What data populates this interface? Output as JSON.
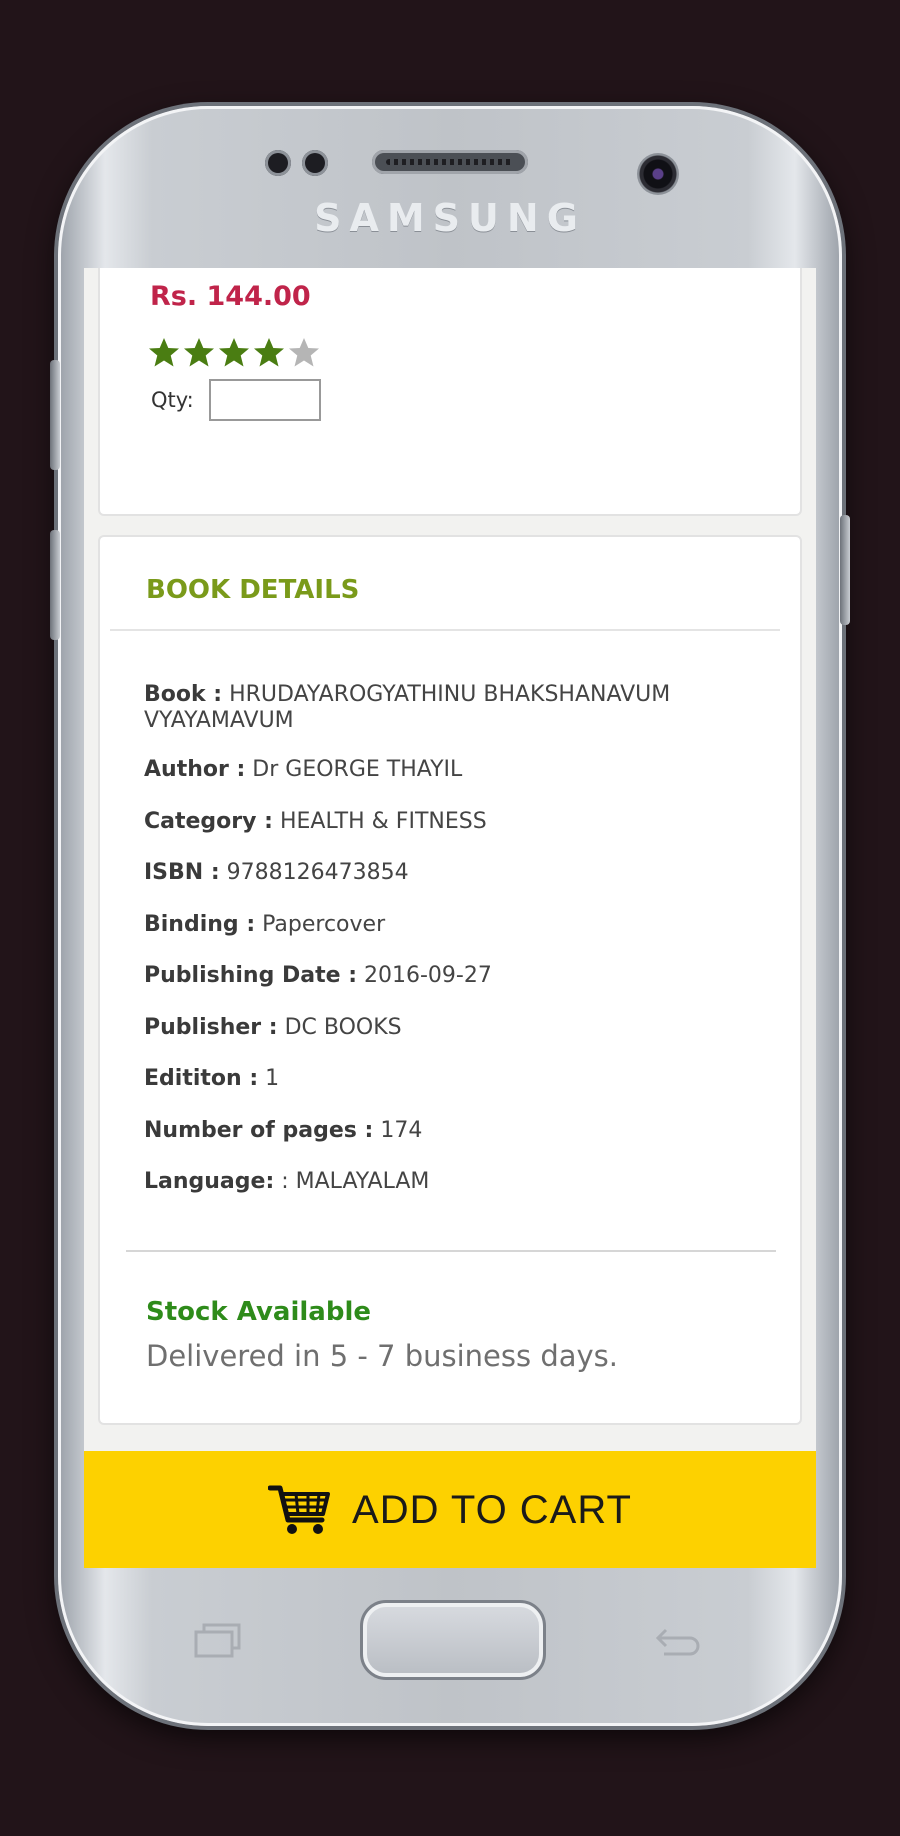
{
  "device": {
    "brand": "SAMSUNG"
  },
  "product": {
    "price": "Rs. 144.00",
    "rating": 4,
    "rating_max": 5,
    "qty_label": "Qty:",
    "qty_value": ""
  },
  "details": {
    "title": "BOOK DETAILS",
    "rows": [
      {
        "label": "Book :",
        "value": "HRUDAYAROGYATHINU BHAKSHANAVUM VYAYAMAVUM"
      },
      {
        "label": "Author :",
        "value": "Dr GEORGE THAYIL"
      },
      {
        "label": "Category :",
        "value": "HEALTH & FITNESS"
      },
      {
        "label": "ISBN :",
        "value": "9788126473854"
      },
      {
        "label": "Binding :",
        "value": "Papercover"
      },
      {
        "label": "Publishing Date :",
        "value": "2016-09-27"
      },
      {
        "label": "Publisher :",
        "value": "DC BOOKS"
      },
      {
        "label": "Edititon :",
        "value": "1"
      },
      {
        "label": "Number of pages :",
        "value": "174"
      },
      {
        "label": "Language:",
        "value": ": MALAYALAM"
      }
    ]
  },
  "availability": {
    "status": "Stock Available",
    "delivery": "Delivered in 5 - 7  business days."
  },
  "cart": {
    "label": "ADD TO CART"
  },
  "colors": {
    "price": "#c0244a",
    "star_filled": "#4a7d12",
    "star_empty": "#b5b5b5",
    "section_title": "#7a9a1a",
    "stock": "#2e8b1a",
    "cart_bar": "#fdd100"
  },
  "icons": [
    "cart-icon",
    "star-icon",
    "recent-apps-icon",
    "back-icon"
  ]
}
